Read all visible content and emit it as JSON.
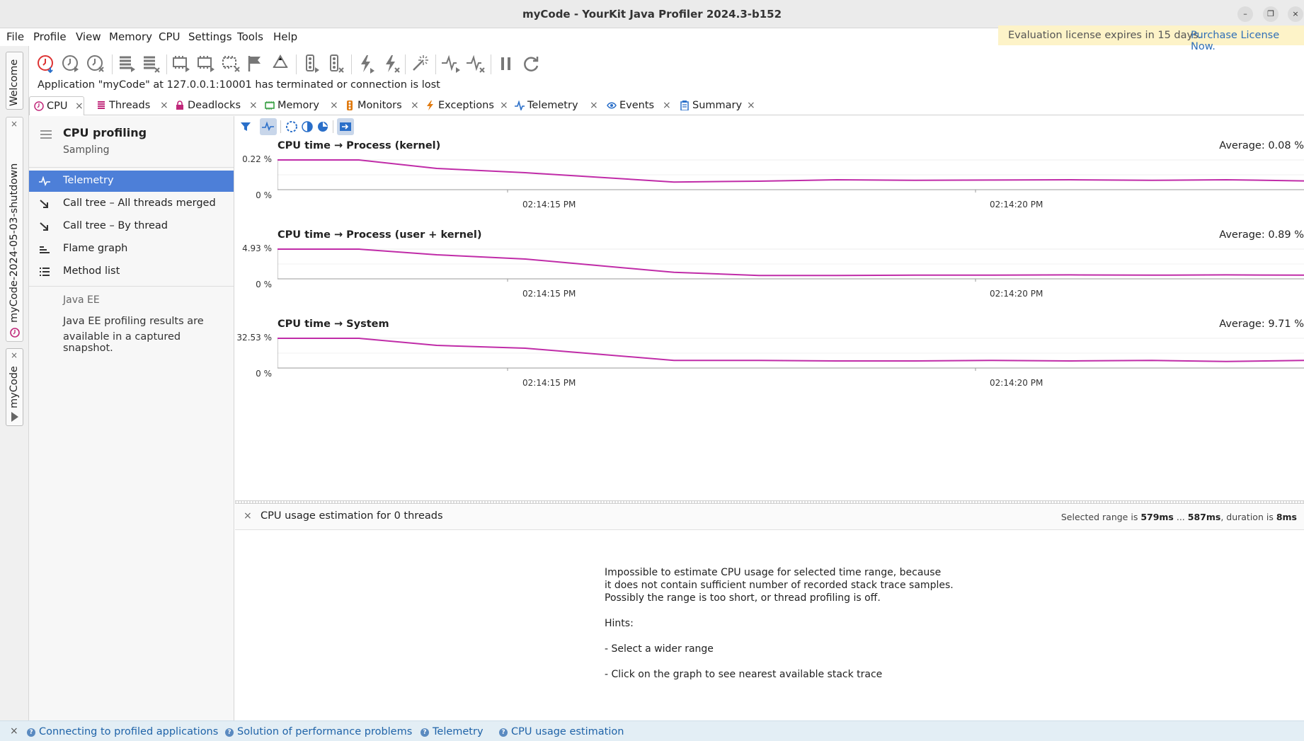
{
  "window": {
    "title": "myCode - YourKit Java Profiler 2024.3-b152",
    "minimize": "–",
    "restore": "❐",
    "close": "×"
  },
  "menu": {
    "items": [
      "File",
      "Profile",
      "View",
      "Memory",
      "CPU",
      "Settings",
      "Tools",
      "Help"
    ]
  },
  "license": {
    "text": "Evaluation license expires in 15 days.",
    "link": "Purchase License Now."
  },
  "side_tabs": {
    "welcome": "Welcome",
    "snapshot": "myCode-2024-05-03-shutdown",
    "session": "myCode"
  },
  "status_message": "Application \"myCode\" at 127.0.0.1:10001 has terminated or connection is lost",
  "tabs": [
    "CPU",
    "Threads",
    "Deadlocks",
    "Memory",
    "Monitors",
    "Exceptions",
    "Telemetry",
    "Events",
    "Summary"
  ],
  "nav": {
    "title": "CPU profiling",
    "subtitle": "Sampling",
    "items": [
      "Telemetry",
      "Call tree – All threads merged",
      "Call tree – By thread",
      "Flame graph",
      "Method list"
    ],
    "section": "Java EE",
    "section_text_1": "Java EE profiling results are",
    "section_text_2": "available in a captured snapshot."
  },
  "charts": [
    {
      "title": "CPU time → Process (kernel)",
      "average": "Average: 0.08 %",
      "ymax": "0.22 %",
      "ymin": "0 %",
      "xticks": [
        "02:14:15 PM",
        "02:14:20 PM"
      ]
    },
    {
      "title": "CPU time → Process (user + kernel)",
      "average": "Average: 0.89 %",
      "ymax": "4.93 %",
      "ymin": "0 %",
      "xticks": [
        "02:14:15 PM",
        "02:14:20 PM"
      ]
    },
    {
      "title": "CPU time → System",
      "average": "Average: 9.71 %",
      "ymax": "32.53 %",
      "ymin": "0 %",
      "xticks": [
        "02:14:15 PM",
        "02:14:20 PM"
      ]
    }
  ],
  "lower": {
    "close": "×",
    "title": "CPU usage estimation for 0 threads",
    "range_prefix": "Selected range is",
    "range_start": "579ms",
    "range_sep": "...",
    "range_end": "587ms",
    "range_mid": ", duration is",
    "range_dur": "8ms",
    "msg1": "Impossible to estimate CPU usage for selected time range, because",
    "msg2": "it does not contain sufficient number of recorded stack trace samples.",
    "msg3": "Possibly the range is too short, or thread profiling is off.",
    "hints": "Hints:",
    "hint1": "- Select a wider range",
    "hint2": "- Click on the graph to see nearest available stack trace"
  },
  "bottom_hints": [
    "Connecting to profiled applications",
    "Solution of performance problems",
    "Telemetry",
    "CPU usage estimation"
  ],
  "colors": {
    "line": "#c02ca8",
    "selected_nav": "#4d7fd8",
    "license_bg": "#fdf3c8",
    "link": "#2f6fb7"
  }
}
